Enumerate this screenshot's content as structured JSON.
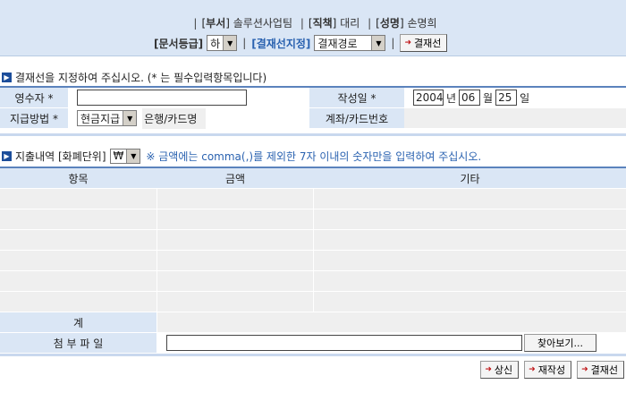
{
  "header": {
    "dept_label": "부서",
    "dept_value": "솔루션사업팀",
    "position_label": "직책",
    "position_value": "대리",
    "name_label": "성명",
    "name_value": "손명희",
    "doc_grade_label": "문서등급",
    "doc_grade_value": "하",
    "approver_label": "결재선지정",
    "approval_route_value": "결재경로",
    "approver_button": "결재선"
  },
  "section1": {
    "title": "결재선을 지정하여 주십시오. (* 는 필수입력항목입니다)",
    "receiver_label": "영수자 *",
    "receiver_value": "",
    "date_label": "작성일 *",
    "year": "2004",
    "year_unit": "년",
    "month": "06",
    "month_unit": "월",
    "day": "25",
    "day_unit": "일",
    "payment_label": "지급방법 *",
    "payment_value": "현금지급",
    "bank_label": "은행/카드명",
    "account_label": "계좌/카드번호"
  },
  "section2": {
    "title_prefix": "지출내역 [화폐단위]",
    "currency_value": "₩",
    "notice": "※ 금액에는 comma(,)를 제외한 7자 이내의 숫자만을 입력하여 주십시오.",
    "notice_color": "#2a62b0"
  },
  "grid": {
    "columns": [
      "항목",
      "금액",
      "기타"
    ],
    "empty_rows": 6,
    "total_label": "계",
    "attachment_label": "첨 부 파 일",
    "attachment_value": "",
    "browse_button": "찾아보기..."
  },
  "footer": {
    "submit_button": "상신",
    "rewrite_button": "재작성",
    "approver_button": "결재선"
  },
  "colors": {
    "header_bg": "#dae6f5",
    "accent": "#5b83bd",
    "cell_gray": "#efefef",
    "arrow_red": "#c0181a"
  }
}
